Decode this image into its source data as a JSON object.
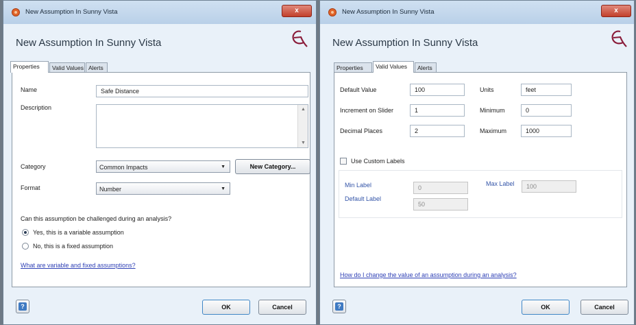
{
  "left_dialog": {
    "window_title": "New Assumption In Sunny Vista",
    "close_label": "x",
    "header_title": "New Assumption In Sunny Vista",
    "tabs": [
      {
        "label": "Properties",
        "active": true
      },
      {
        "label": "Valid Values",
        "active": false
      },
      {
        "label": "Alerts",
        "active": false
      }
    ],
    "name_label": "Name",
    "name_value": "Safe Distance",
    "description_label": "Description",
    "description_value": "",
    "category_label": "Category",
    "category_value": "Common Impacts",
    "new_category_button": "New Category...",
    "format_label": "Format",
    "format_value": "Number",
    "question": "Can this assumption be challenged during an analysis?",
    "radio_variable": "Yes, this is a variable assumption",
    "radio_fixed": "No, this is a fixed assumption",
    "selected_radio": "variable",
    "help_link": "What are variable and fixed assumptions?",
    "help_button": "?",
    "ok_button": "OK",
    "cancel_button": "Cancel"
  },
  "right_dialog": {
    "window_title": "New Assumption In Sunny Vista",
    "close_label": "x",
    "header_title": "New Assumption In Sunny Vista",
    "tabs": [
      {
        "label": "Properties",
        "active": false
      },
      {
        "label": "Valid Values",
        "active": true
      },
      {
        "label": "Alerts",
        "active": false
      }
    ],
    "default_value_label": "Default Value",
    "default_value": "100",
    "increment_label": "Increment on Slider",
    "increment_value": "1",
    "decimal_places_label": "Decimal Places",
    "decimal_places_value": "2",
    "units_label": "Units",
    "units_value": "feet",
    "minimum_label": "Minimum",
    "minimum_value": "0",
    "maximum_label": "Maximum",
    "maximum_value": "1000",
    "use_custom_labels": "Use Custom Labels",
    "use_custom_labels_checked": false,
    "min_label_label": "Min Label",
    "min_label_value": "0",
    "max_label_label": "Max Label",
    "max_label_value": "100",
    "default_label_label": "Default Label",
    "default_label_value": "50",
    "help_link": "How do I change the value of an assumption during an analysis?",
    "help_button": "?",
    "ok_button": "OK",
    "cancel_button": "Cancel"
  },
  "colors": {
    "dialog_bg": "#e9f1f9",
    "titlebar": "#c4d8ed",
    "close_button": "#c94a36",
    "link": "#2d3fb5",
    "logo": "#8a1c3a"
  },
  "icons": {
    "app_icon": "app-icon",
    "logo": "ev-logo-icon",
    "help": "help-icon",
    "dropdown": "chevron-down-icon"
  }
}
